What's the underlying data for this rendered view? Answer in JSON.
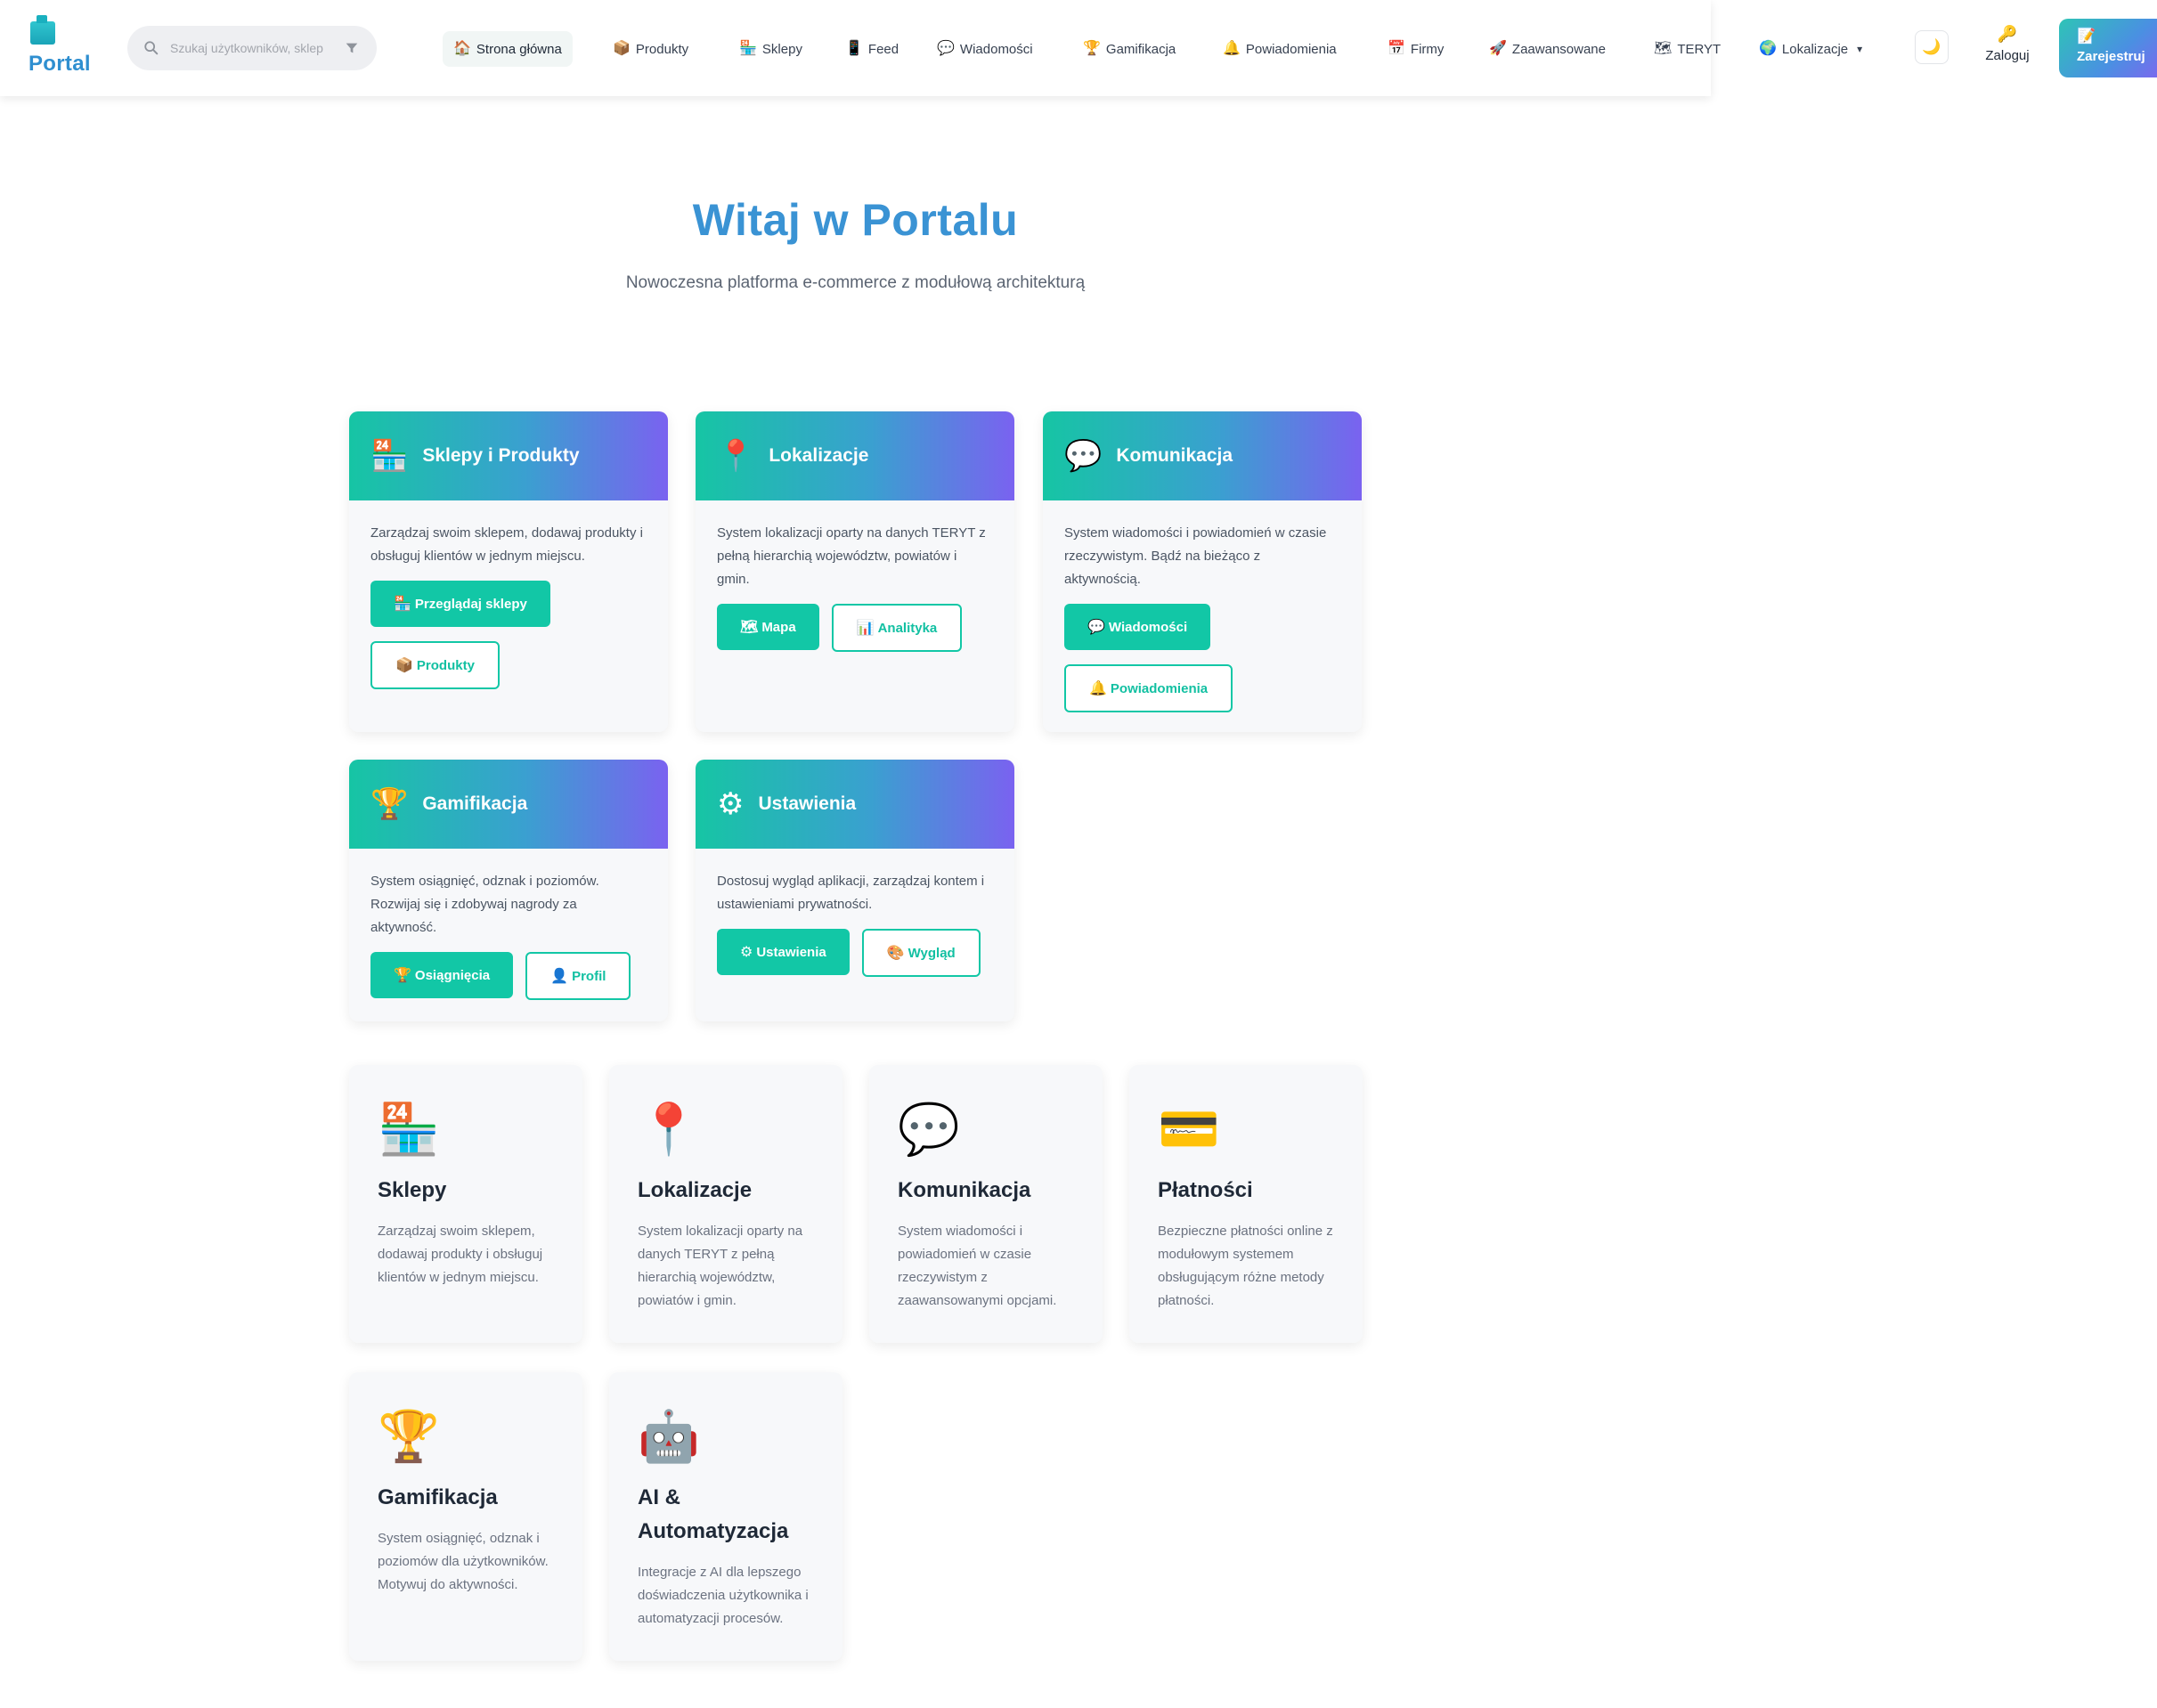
{
  "brand": {
    "name": "Portal"
  },
  "search": {
    "placeholder": "Szukaj użytkowników, sklep"
  },
  "nav": {
    "items": [
      {
        "icon": "🏠",
        "label": "Strona główna"
      },
      {
        "icon": "📦",
        "label": "Produkty"
      },
      {
        "icon": "🏪",
        "label": "Sklepy"
      },
      {
        "icon": "📱",
        "label": "Feed"
      },
      {
        "icon": "💬",
        "label": "Wiadomości"
      },
      {
        "icon": "🏆",
        "label": "Gamifikacja"
      },
      {
        "icon": "🔔",
        "label": "Powiadomienia"
      },
      {
        "icon": "📅",
        "label": "Firmy"
      },
      {
        "icon": "🚀",
        "label": "Zaawansowane"
      },
      {
        "icon": "🗺",
        "label": "TERYT"
      },
      {
        "icon": "🌍",
        "label": "Lokalizacje"
      }
    ],
    "active": "Strona główna",
    "theme_icon": "🌙",
    "login": {
      "icon": "🔑",
      "label": "Zaloguj"
    },
    "register": {
      "icon": "📝",
      "label": "Zarejestruj"
    }
  },
  "hero": {
    "title": "Witaj w Portalu",
    "subtitle": "Nowoczesna platforma e-commerce z modułową architekturą"
  },
  "modules": [
    {
      "icon": "🏪",
      "title": "Sklepy i Produkty",
      "description": "Zarządzaj swoim sklepem, dodawaj produkty i obsługuj klientów w jednym miejscu.",
      "buttons": [
        {
          "icon": "🏪",
          "label": "Przeglądaj sklepy",
          "style": "primary"
        },
        {
          "icon": "📦",
          "label": "Produkty",
          "style": "outline"
        }
      ]
    },
    {
      "icon": "📍",
      "title": "Lokalizacje",
      "description": "System lokalizacji oparty na danych TERYT z pełną hierarchią województw, powiatów i gmin.",
      "buttons": [
        {
          "icon": "🗺",
          "label": "Mapa",
          "style": "primary"
        },
        {
          "icon": "📊",
          "label": "Analityka",
          "style": "outline"
        }
      ]
    },
    {
      "icon": "💬",
      "title": "Komunikacja",
      "description": "System wiadomości i powiadomień w czasie rzeczywistym. Bądź na bieżąco z aktywnością.",
      "buttons": [
        {
          "icon": "💬",
          "label": "Wiadomości",
          "style": "primary"
        },
        {
          "icon": "🔔",
          "label": "Powiadomienia",
          "style": "outline"
        }
      ]
    },
    {
      "icon": "🏆",
      "title": "Gamifikacja",
      "description": "System osiągnięć, odznak i poziomów. Rozwijaj się i zdobywaj nagrody za aktywność.",
      "buttons": [
        {
          "icon": "🏆",
          "label": "Osiągnięcia",
          "style": "primary"
        },
        {
          "icon": "👤",
          "label": "Profil",
          "style": "outline"
        }
      ]
    },
    {
      "icon": "⚙",
      "title": "Ustawienia",
      "description": "Dostosuj wygląd aplikacji, zarządzaj kontem i ustawieniami prywatności.",
      "buttons": [
        {
          "icon": "⚙",
          "label": "Ustawienia",
          "style": "primary"
        },
        {
          "icon": "🎨",
          "label": "Wygląd",
          "style": "outline"
        }
      ]
    }
  ],
  "features": [
    {
      "icon": "🏪",
      "title": "Sklepy",
      "description": "Zarządzaj swoim sklepem, dodawaj produkty i obsługuj klientów w jednym miejscu."
    },
    {
      "icon": "📍",
      "title": "Lokalizacje",
      "description": "System lokalizacji oparty na danych TERYT z pełną hierarchią województw, powiatów i gmin."
    },
    {
      "icon": "💬",
      "title": "Komunikacja",
      "description": "System wiadomości i powiadomień w czasie rzeczywistym z zaawansowanymi opcjami."
    },
    {
      "icon": "💳",
      "title": "Płatności",
      "description": "Bezpieczne płatności online z modułowym systemem obsługującym różne metody płatności."
    },
    {
      "icon": "🏆",
      "title": "Gamifikacja",
      "description": "System osiągnięć, odznak i poziomów dla użytkowników. Motywuj do aktywności."
    },
    {
      "icon": "🤖",
      "title": "AI & Automatyzacja",
      "description": "Integracje z AI dla lepszego doświadczenia użytkownika i automatyzacji procesów."
    }
  ],
  "colors": {
    "accent": "#12c7a6",
    "brand": "#3a93d4",
    "gradient": [
      "#16c5a4",
      "#3aa0d0",
      "#7a62f0"
    ]
  }
}
